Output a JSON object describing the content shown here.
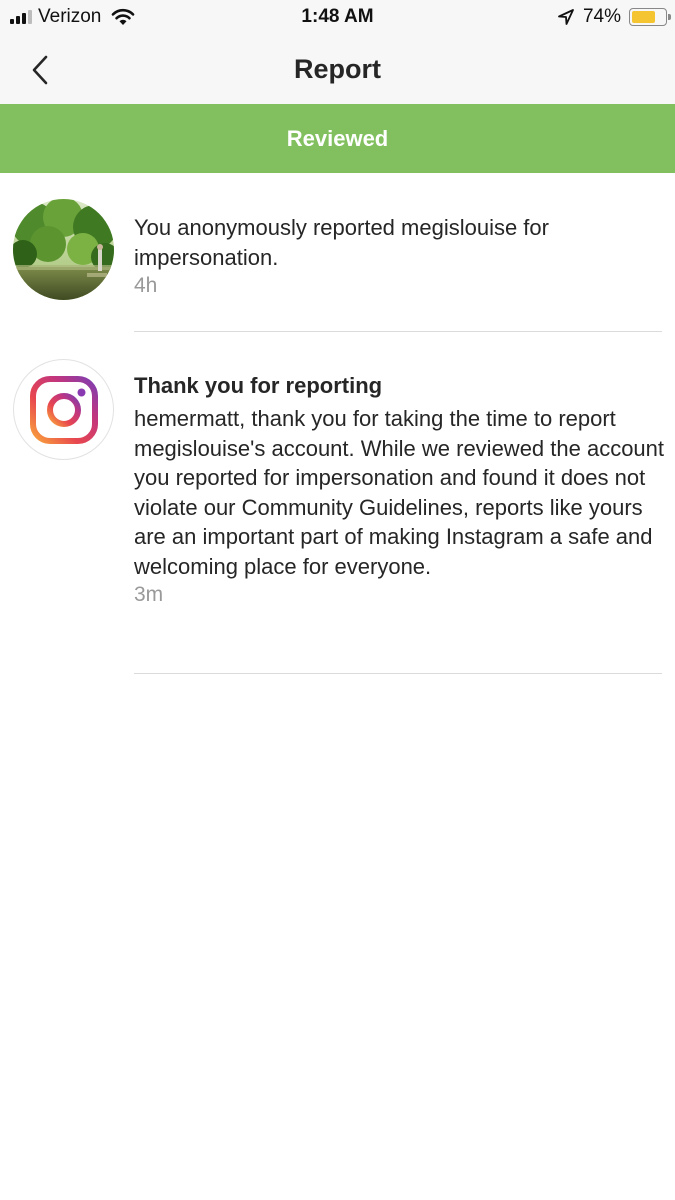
{
  "status_bar": {
    "carrier": "Verizon",
    "time": "1:48 AM",
    "battery_percent": "74%",
    "battery_level": 0.74,
    "signal_bars": 3
  },
  "nav": {
    "title": "Report"
  },
  "banner": {
    "label": "Reviewed",
    "color": "#82c05f"
  },
  "items": [
    {
      "text": "You anonymously reported megislouise for impersonation.",
      "time": "4h",
      "avatar": "profile-photo"
    },
    {
      "title": "Thank you for reporting",
      "text": "hemermatt, thank you for taking the time to report megislouise's account. While we reviewed the account you reported for impersonation and found it does not violate our Community Guidelines, reports like yours are an important part of making Instagram a safe and welcoming place for everyone.",
      "time": "3m",
      "avatar": "instagram-logo"
    }
  ]
}
